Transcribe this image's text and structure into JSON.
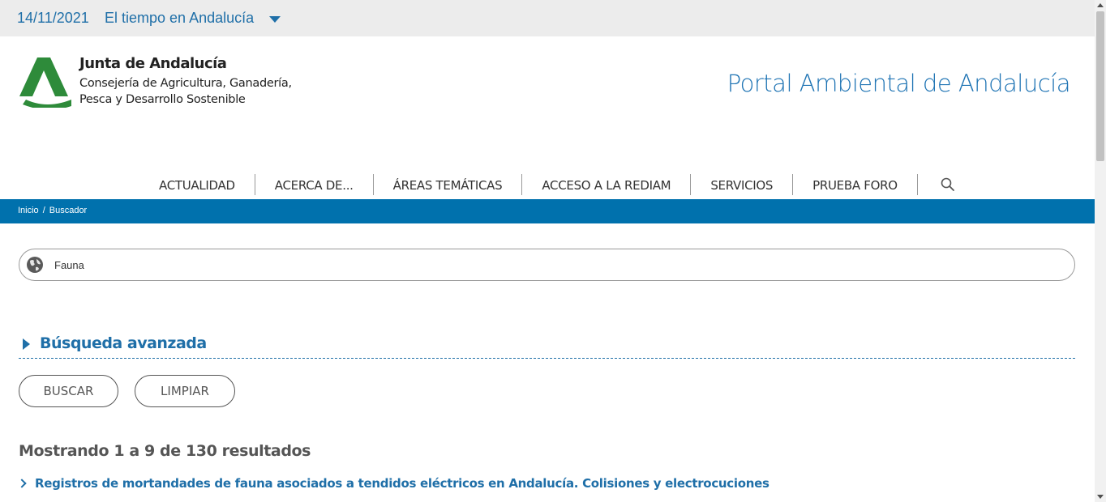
{
  "topbar": {
    "date": "14/11/2021",
    "weather_link": "El tiempo en Andalucía"
  },
  "header": {
    "org_name": "Junta de Andalucía",
    "org_sub_line1": "Consejería de Agricultura, Ganadería,",
    "org_sub_line2": "Pesca y Desarrollo Sostenible",
    "portal_title": "Portal Ambiental de Andalucía"
  },
  "nav": {
    "items": [
      {
        "label": "ACTUALIDAD"
      },
      {
        "label": "ACERCA DE..."
      },
      {
        "label": "ÁREAS TEMÁTICAS"
      },
      {
        "label": "ACCESO A LA REDIAM"
      },
      {
        "label": "SERVICIOS"
      },
      {
        "label": "PRUEBA FORO"
      }
    ]
  },
  "breadcrumb": {
    "home": "Inicio",
    "separator": "/",
    "current": "Buscador"
  },
  "search": {
    "value": "Fauna"
  },
  "advanced": {
    "label": "Búsqueda avanzada"
  },
  "buttons": {
    "search": "BUSCAR",
    "clear": "LIMPIAR"
  },
  "results": {
    "summary": "Mostrando 1 a 9 de 130 resultados",
    "items": [
      {
        "title": "Registros de mortandades de fauna asociados a tendidos eléctricos en Andalucía. Colisiones y electrocuciones"
      }
    ]
  },
  "colors": {
    "brand_blue": "#1f6fa8",
    "bar_blue": "#0071ad",
    "logo_green": "#2e8b3a"
  }
}
